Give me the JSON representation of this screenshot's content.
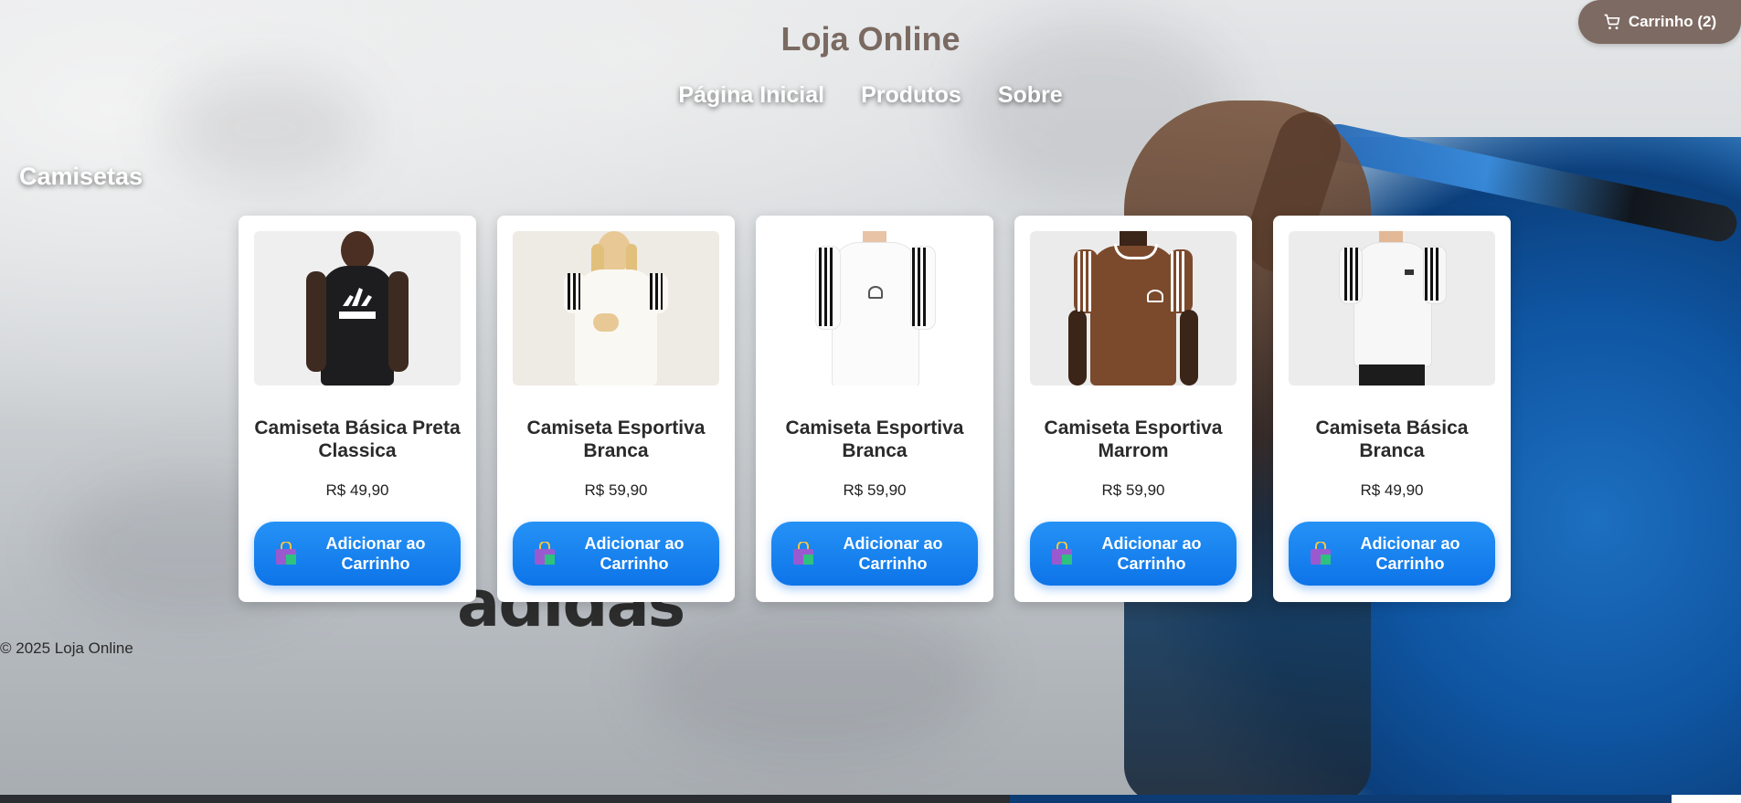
{
  "header": {
    "title": "Loja Online",
    "nav": [
      "Página Inicial",
      "Produtos",
      "Sobre"
    ],
    "cart_label": "Carrinho (2)"
  },
  "section": {
    "title": "Camisetas"
  },
  "products": [
    {
      "name": "Camiseta Básica Preta Classica",
      "price": "R$ 49,90",
      "button": "Adicionar ao Carrinho"
    },
    {
      "name": "Camiseta Esportiva Branca",
      "price": "R$ 59,90",
      "button": "Adicionar ao Carrinho"
    },
    {
      "name": "Camiseta Esportiva Branca",
      "price": "R$ 59,90",
      "button": "Adicionar ao Carrinho"
    },
    {
      "name": "Camiseta Esportiva Marrom",
      "price": "R$ 59,90",
      "button": "Adicionar ao Carrinho"
    },
    {
      "name": "Camiseta Básica Branca",
      "price": "R$ 49,90",
      "button": "Adicionar ao Carrinho"
    }
  ],
  "footer": {
    "text": "© 2025 Loja Online"
  },
  "background_text": "adidas",
  "colors": {
    "brand_brown": "#7d6a62",
    "button_blue": "#0d74e8",
    "title_brown": "#7a6a62"
  },
  "icons": {
    "cart": "shopping-cart-icon",
    "add": "shopping-bag-icon"
  }
}
